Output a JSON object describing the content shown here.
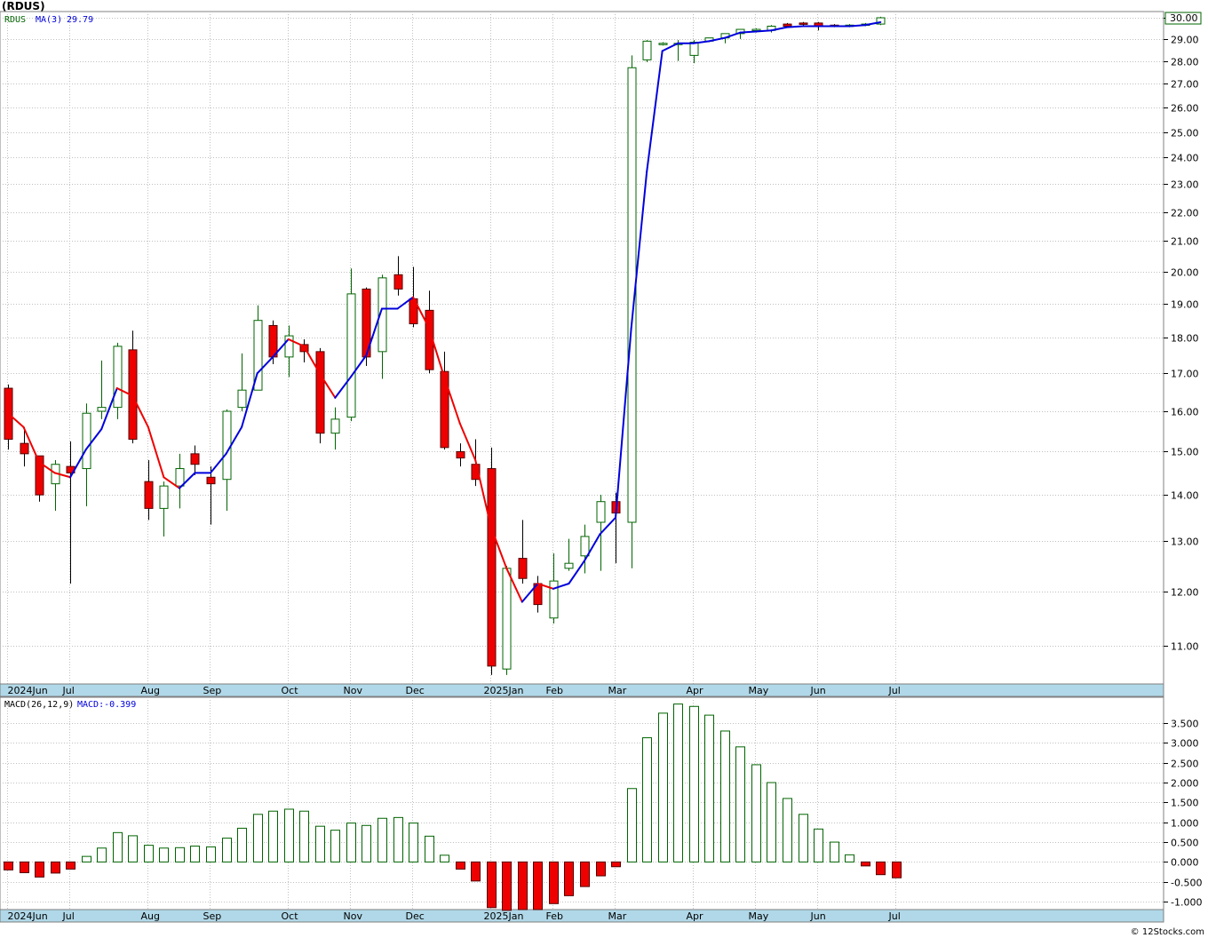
{
  "title": "(RDUS)",
  "footer": "© 12Stocks.com",
  "colors": {
    "up": "#006400",
    "down": "#ee0000",
    "ma_up": "#0000dd",
    "ma_down": "#ee0000",
    "band": "#b0d8e8",
    "grid": "#c0c0c0"
  },
  "legend": {
    "symbol": "RDUS",
    "ma": "MA(3)",
    "ma_value": "29.79",
    "macd_name": "MACD(26,12,9)",
    "macd_value": "MACD:-0.399"
  },
  "last_price_label": "30.00",
  "chart_data": [
    {
      "type": "candlestick",
      "ylim": [
        10.35,
        30.3
      ],
      "yscale": "log",
      "y_ticks": [
        "11.00",
        "12.00",
        "13.00",
        "14.00",
        "15.00",
        "16.00",
        "17.00",
        "18.00",
        "19.00",
        "20.00",
        "21.00",
        "22.00",
        "23.00",
        "24.00",
        "25.00",
        "26.00",
        "27.00",
        "28.00",
        "29.00",
        "30.00"
      ],
      "x_ticks": [
        "2024Jun",
        "Jul",
        "Aug",
        "Sep",
        "Oct",
        "Nov",
        "Dec",
        "2025Jan",
        "Feb",
        "Mar",
        "Apr",
        "May",
        "Jun",
        "Jul"
      ],
      "candles": [
        {
          "o": 16.6,
          "h": 16.7,
          "l": 15.05,
          "c": 15.3
        },
        {
          "o": 15.2,
          "h": 15.6,
          "l": 14.65,
          "c": 14.95
        },
        {
          "o": 14.9,
          "h": 14.9,
          "l": 13.85,
          "c": 14.0
        },
        {
          "o": 14.25,
          "h": 14.8,
          "l": 13.65,
          "c": 14.7
        },
        {
          "o": 14.65,
          "h": 15.25,
          "l": 12.15,
          "c": 14.5
        },
        {
          "o": 14.6,
          "h": 16.2,
          "l": 13.75,
          "c": 15.95
        },
        {
          "o": 16.0,
          "h": 17.35,
          "l": 15.8,
          "c": 16.1
        },
        {
          "o": 16.1,
          "h": 17.85,
          "l": 15.8,
          "c": 17.75
        },
        {
          "o": 17.65,
          "h": 18.2,
          "l": 15.2,
          "c": 15.3
        },
        {
          "o": 14.3,
          "h": 14.8,
          "l": 13.45,
          "c": 13.7
        },
        {
          "o": 13.7,
          "h": 14.3,
          "l": 13.1,
          "c": 14.2
        },
        {
          "o": 14.2,
          "h": 14.95,
          "l": 13.7,
          "c": 14.6
        },
        {
          "o": 14.95,
          "h": 15.15,
          "l": 14.45,
          "c": 14.7
        },
        {
          "o": 14.4,
          "h": 14.65,
          "l": 13.35,
          "c": 14.25
        },
        {
          "o": 14.35,
          "h": 16.05,
          "l": 13.65,
          "c": 16.0
        },
        {
          "o": 16.1,
          "h": 17.55,
          "l": 16.0,
          "c": 16.55
        },
        {
          "o": 16.55,
          "h": 18.95,
          "l": 16.55,
          "c": 18.5
        },
        {
          "o": 18.35,
          "h": 18.5,
          "l": 17.25,
          "c": 17.45
        },
        {
          "o": 17.45,
          "h": 18.35,
          "l": 16.9,
          "c": 18.05
        },
        {
          "o": 17.8,
          "h": 17.95,
          "l": 17.3,
          "c": 17.6
        },
        {
          "o": 17.6,
          "h": 17.7,
          "l": 15.2,
          "c": 15.45
        },
        {
          "o": 15.45,
          "h": 16.1,
          "l": 15.05,
          "c": 15.8
        },
        {
          "o": 15.85,
          "h": 20.1,
          "l": 15.75,
          "c": 19.3
        },
        {
          "o": 19.45,
          "h": 19.5,
          "l": 17.2,
          "c": 17.45
        },
        {
          "o": 17.6,
          "h": 19.9,
          "l": 16.85,
          "c": 19.8
        },
        {
          "o": 19.9,
          "h": 20.5,
          "l": 19.25,
          "c": 19.45
        },
        {
          "o": 19.15,
          "h": 20.15,
          "l": 18.3,
          "c": 18.4
        },
        {
          "o": 18.8,
          "h": 19.4,
          "l": 17.0,
          "c": 17.1
        },
        {
          "o": 17.05,
          "h": 17.6,
          "l": 15.05,
          "c": 15.1
        },
        {
          "o": 15.0,
          "h": 15.2,
          "l": 14.65,
          "c": 14.85
        },
        {
          "o": 14.7,
          "h": 15.3,
          "l": 14.2,
          "c": 14.35
        },
        {
          "o": 14.6,
          "h": 15.1,
          "l": 10.5,
          "c": 10.65
        },
        {
          "o": 10.6,
          "h": 12.5,
          "l": 10.5,
          "c": 12.45
        },
        {
          "o": 12.65,
          "h": 13.45,
          "l": 12.15,
          "c": 12.25
        },
        {
          "o": 12.15,
          "h": 12.3,
          "l": 11.6,
          "c": 11.75
        },
        {
          "o": 11.5,
          "h": 12.75,
          "l": 11.4,
          "c": 12.2
        },
        {
          "o": 12.45,
          "h": 13.05,
          "l": 12.4,
          "c": 12.55
        },
        {
          "o": 12.7,
          "h": 13.35,
          "l": 12.35,
          "c": 13.1
        },
        {
          "o": 13.4,
          "h": 14.0,
          "l": 12.4,
          "c": 13.85
        },
        {
          "o": 13.85,
          "h": 14.05,
          "l": 12.55,
          "c": 13.6
        },
        {
          "o": 13.4,
          "h": 28.25,
          "l": 12.45,
          "c": 27.7
        },
        {
          "o": 28.05,
          "h": 28.95,
          "l": 27.95,
          "c": 28.9
        },
        {
          "o": 28.8,
          "h": 28.85,
          "l": 28.7,
          "c": 28.8
        },
        {
          "o": 28.75,
          "h": 28.95,
          "l": 28.0,
          "c": 28.8
        },
        {
          "o": 28.25,
          "h": 28.95,
          "l": 27.9,
          "c": 28.85
        },
        {
          "o": 28.9,
          "h": 29.05,
          "l": 28.85,
          "c": 29.05
        },
        {
          "o": 29.05,
          "h": 29.25,
          "l": 28.8,
          "c": 29.25
        },
        {
          "o": 29.25,
          "h": 29.45,
          "l": 29.0,
          "c": 29.45
        },
        {
          "o": 29.45,
          "h": 29.5,
          "l": 29.3,
          "c": 29.45
        },
        {
          "o": 29.4,
          "h": 29.65,
          "l": 29.3,
          "c": 29.6
        },
        {
          "o": 29.7,
          "h": 29.75,
          "l": 29.55,
          "c": 29.6
        },
        {
          "o": 29.75,
          "h": 29.8,
          "l": 29.6,
          "c": 29.7
        },
        {
          "o": 29.75,
          "h": 29.8,
          "l": 29.4,
          "c": 29.6
        },
        {
          "o": 29.65,
          "h": 29.7,
          "l": 29.55,
          "c": 29.6
        },
        {
          "o": 29.6,
          "h": 29.7,
          "l": 29.55,
          "c": 29.65
        },
        {
          "o": 29.7,
          "h": 29.75,
          "l": 29.6,
          "c": 29.7
        },
        {
          "o": 29.7,
          "h": 30.05,
          "l": 29.65,
          "c": 30.0
        }
      ],
      "ma3": [
        15.95,
        15.6,
        14.75,
        14.5,
        14.4,
        15.05,
        15.55,
        16.6,
        16.4,
        15.6,
        14.4,
        14.15,
        14.5,
        14.5,
        14.95,
        15.6,
        17.0,
        17.45,
        17.95,
        17.75,
        17.0,
        16.35,
        16.9,
        17.5,
        18.85,
        18.85,
        19.2,
        18.3,
        16.9,
        15.7,
        14.8,
        13.3,
        12.45,
        11.8,
        12.15,
        12.05,
        12.15,
        12.6,
        13.15,
        13.5,
        18.25,
        23.45,
        28.45,
        28.8,
        28.8,
        28.9,
        29.05,
        29.3,
        29.35,
        29.4,
        29.55,
        29.6,
        29.6,
        29.6,
        29.6,
        29.65,
        29.79
      ]
    },
    {
      "type": "bar",
      "name": "MACD(26,12,9)",
      "ylim": [
        -1.2,
        4.15
      ],
      "y_ticks": [
        "-1.000",
        "-0.500",
        "0.000",
        "0.500",
        "1.000",
        "1.500",
        "2.000",
        "2.500",
        "3.000",
        "3.500"
      ],
      "x_ticks": [
        "2024Jun",
        "Jul",
        "Aug",
        "Sep",
        "Oct",
        "Nov",
        "Dec",
        "2025Jan",
        "Feb",
        "Mar",
        "Apr",
        "May",
        "Jun",
        "Jul"
      ],
      "values": [
        -0.2,
        -0.27,
        -0.38,
        -0.28,
        -0.18,
        0.14,
        0.35,
        0.74,
        0.66,
        0.42,
        0.35,
        0.36,
        0.4,
        0.38,
        0.6,
        0.85,
        1.2,
        1.28,
        1.33,
        1.28,
        0.9,
        0.8,
        0.98,
        0.92,
        1.1,
        1.12,
        0.98,
        0.65,
        0.17,
        -0.18,
        -0.48,
        -1.15,
        -1.22,
        -1.2,
        -1.2,
        -1.05,
        -0.85,
        -0.62,
        -0.35,
        -0.12,
        1.85,
        3.13,
        3.75,
        3.98,
        3.92,
        3.7,
        3.3,
        2.9,
        2.45,
        2.0,
        1.6,
        1.2,
        0.83,
        0.5,
        0.18,
        -0.1,
        -0.32,
        -0.399
      ]
    }
  ]
}
